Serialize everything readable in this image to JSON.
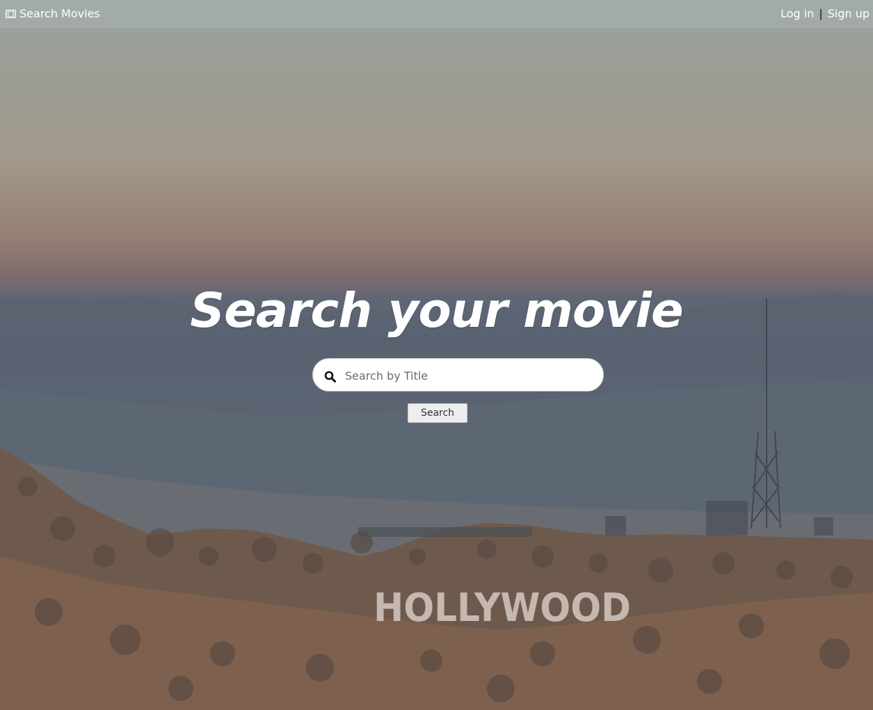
{
  "navbar": {
    "brand_icon": "film-icon",
    "brand_label": "Search Movies",
    "login_label": "Log in",
    "separator": "|",
    "signup_label": "Sign up"
  },
  "hero": {
    "title": "Search your movie"
  },
  "search": {
    "icon": "search-icon",
    "placeholder": "Search by Title",
    "value": "",
    "button_label": "Search"
  },
  "background": {
    "landmark_text": "HOLLYWOOD"
  },
  "colors": {
    "navbar_bg": "#aab2b0",
    "text": "#ffffff",
    "button_bg": "#eeeeee"
  }
}
